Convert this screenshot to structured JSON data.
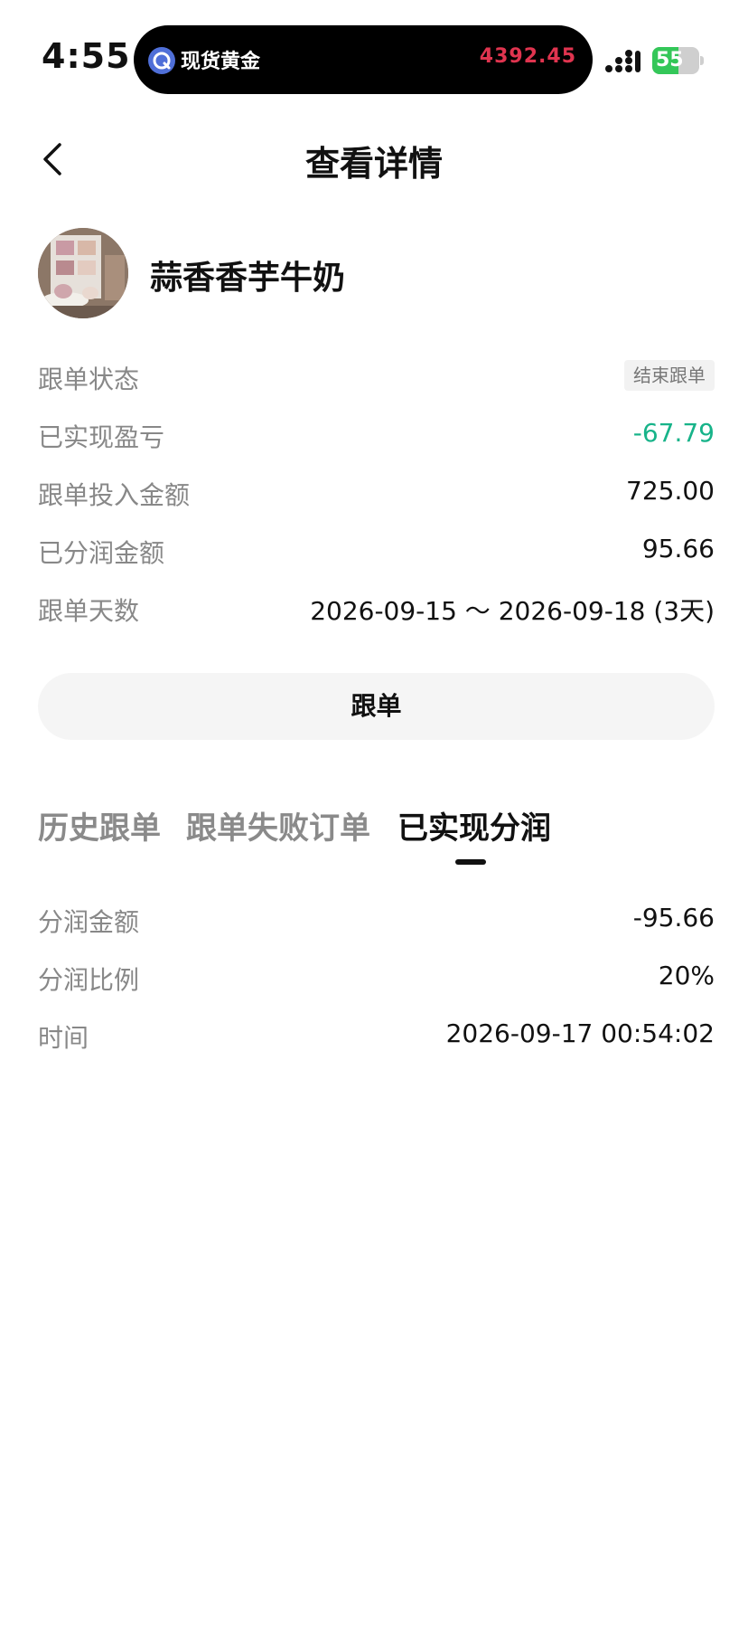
{
  "status_bar": {
    "time": "4:55",
    "island_label": "现货黄金",
    "island_value": "4392.45",
    "battery": "55",
    "battery_level": 0.55,
    "battery_color": "#34c759",
    "price_color": "#e0344f"
  },
  "nav": {
    "back_icon": "chevron-left-icon",
    "title": "查看详情"
  },
  "profile": {
    "username": "蒜香香芋牛奶",
    "avatar_icon": "avatar-photo"
  },
  "info": [
    {
      "label": "跟单状态",
      "value": "结束跟单",
      "kind": "tag"
    },
    {
      "label": "已实现盈亏",
      "value": "-67.79",
      "kind": "negative"
    },
    {
      "label": "跟单投入金额",
      "value": "725.00",
      "kind": "plain"
    },
    {
      "label": "已分润金额",
      "value": "95.66",
      "kind": "plain"
    },
    {
      "label": "跟单天数",
      "value": "2026-09-15 ～ 2026-09-18 (3天)",
      "kind": "plain"
    }
  ],
  "follow_button_label": "跟单",
  "tabs": [
    {
      "label": "历史跟单",
      "active": false
    },
    {
      "label": "跟单失败订单",
      "active": false
    },
    {
      "label": "已实现分润",
      "active": true
    }
  ],
  "details": [
    {
      "label": "分润金额",
      "value": "-95.66"
    },
    {
      "label": "分润比例",
      "value": "20%"
    },
    {
      "label": "时间",
      "value": "2026-09-17 00:54:02"
    }
  ],
  "colors": {
    "negative": "#17b389",
    "label_gray": "#888888",
    "tab_inactive": "#8a8a8a"
  }
}
